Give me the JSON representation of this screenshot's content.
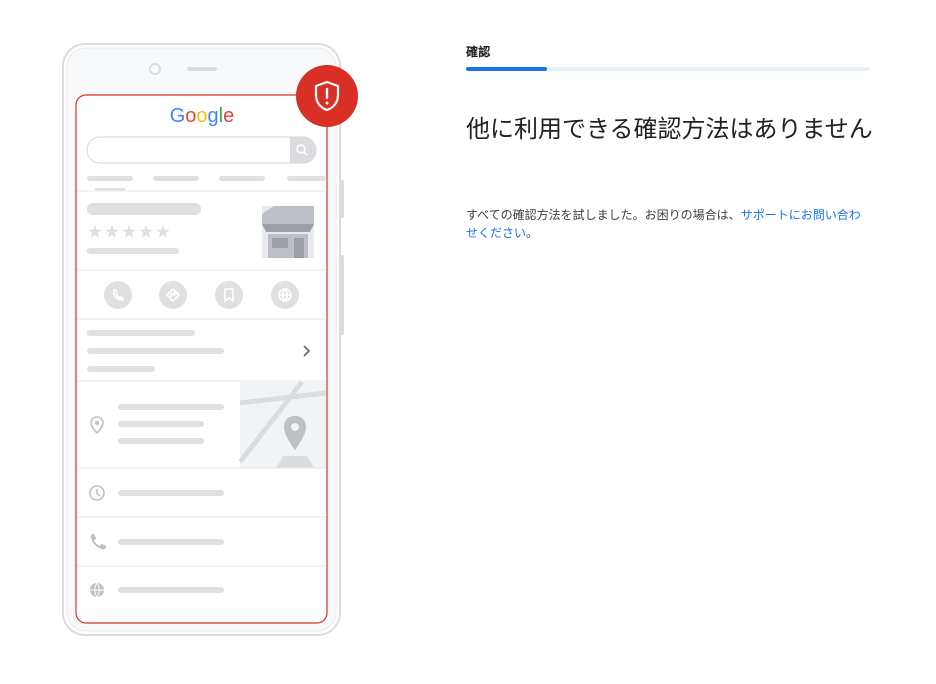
{
  "phone": {
    "logo_text": "Google",
    "logo_colors": [
      "#4285F4",
      "#EA4335",
      "#FBBC05",
      "#4285F4",
      "#34A853",
      "#EA4335"
    ],
    "rating_stars": 5,
    "action_icons": [
      "phone-icon",
      "directions-icon",
      "bookmark-icon",
      "globe-icon"
    ],
    "row_icons": [
      "location-pin-icon",
      "clock-icon",
      "phone-icon",
      "globe-icon"
    ],
    "badge_icon": "shield-alert-icon",
    "colors": {
      "frame": "#dadce0",
      "highlight": "#d93025",
      "placeholder": "#e0e0e0",
      "map": "#f1f3f4"
    }
  },
  "step": {
    "label": "確認",
    "progress": 0.2,
    "colors": {
      "track": "#e8f0fe",
      "fill": "#1a73e8"
    }
  },
  "content": {
    "heading": "他に利用できる確認方法はありません",
    "description_prefix": "すべての確認方法を試しました。お困りの場合は、",
    "support_link": "サポートにお問い合わせください",
    "description_suffix": "。"
  }
}
